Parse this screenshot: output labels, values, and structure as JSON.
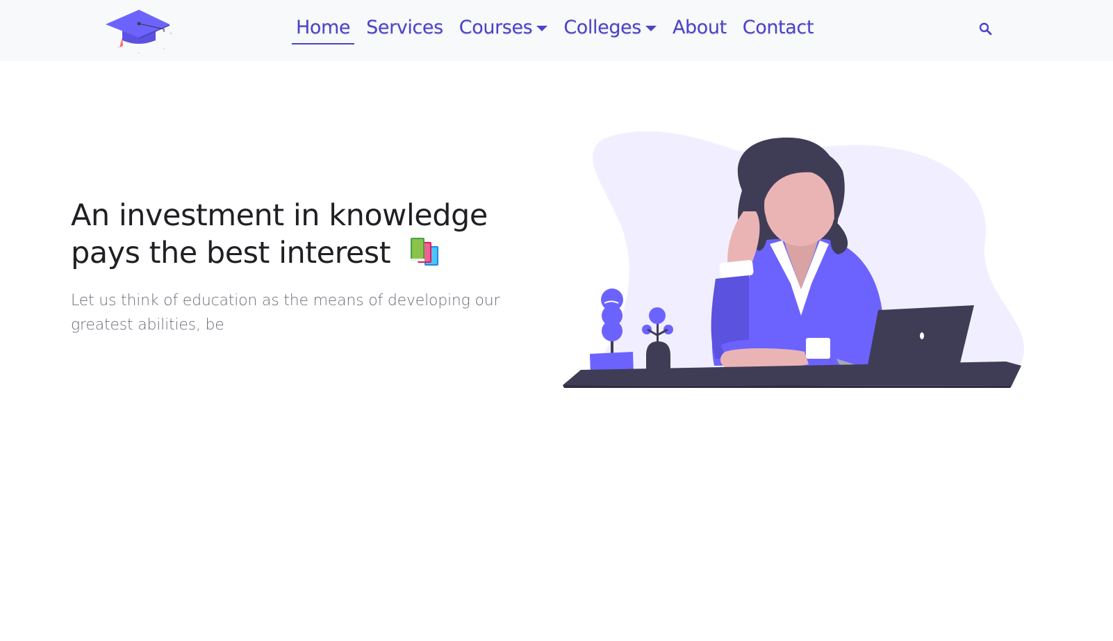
{
  "brand": {
    "logo_icon": "graduation-cap-icon",
    "accent": "#6c5ce7"
  },
  "nav": {
    "items": [
      {
        "label": "Home",
        "active": true,
        "dropdown": false
      },
      {
        "label": "Services",
        "active": false,
        "dropdown": false
      },
      {
        "label": "Courses",
        "active": false,
        "dropdown": true
      },
      {
        "label": "Colleges",
        "active": false,
        "dropdown": true
      },
      {
        "label": "About",
        "active": false,
        "dropdown": false
      },
      {
        "label": "Contact",
        "active": false,
        "dropdown": false
      }
    ],
    "link_color": "#4b43c8",
    "search_icon": "search-icon"
  },
  "hero": {
    "title_line1": "An investment in knowledge",
    "title_line2": "pays the best interest",
    "title_icon": "books-icon",
    "subtitle": "Let us think of education as the means of developing our greatest abilities, be",
    "illustration": "woman-thinking-at-desk-illustration"
  },
  "colors": {
    "primary_purple": "#6c63ff",
    "dark_navy": "#3f3d56",
    "blob": "#f1efff",
    "skin": "#ebb4b4",
    "text_dark": "#1f1f24",
    "text_muted": "#6c6c78"
  }
}
